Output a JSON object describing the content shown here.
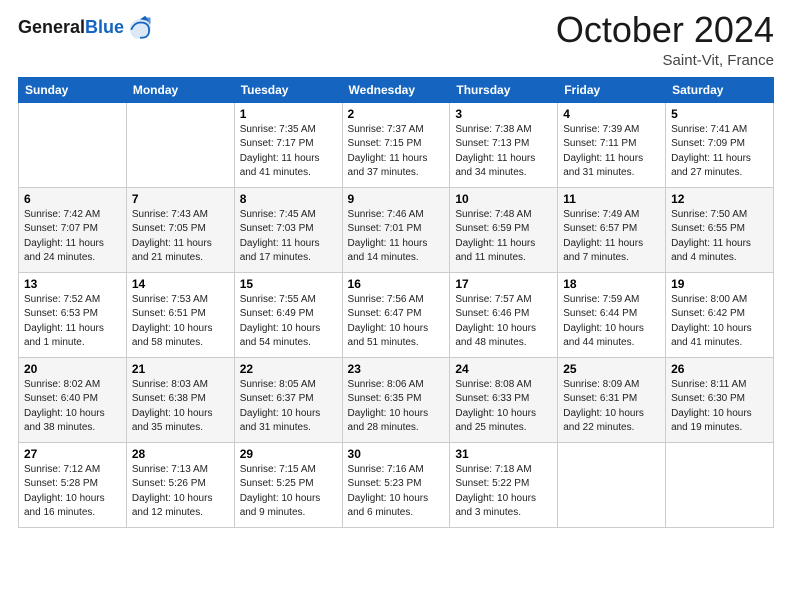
{
  "header": {
    "logo_general": "General",
    "logo_blue": "Blue",
    "month_title": "October 2024",
    "location": "Saint-Vit, France"
  },
  "days_of_week": [
    "Sunday",
    "Monday",
    "Tuesday",
    "Wednesday",
    "Thursday",
    "Friday",
    "Saturday"
  ],
  "weeks": [
    [
      {
        "day": "",
        "sunrise": "",
        "sunset": "",
        "daylight": ""
      },
      {
        "day": "",
        "sunrise": "",
        "sunset": "",
        "daylight": ""
      },
      {
        "day": "1",
        "sunrise": "Sunrise: 7:35 AM",
        "sunset": "Sunset: 7:17 PM",
        "daylight": "Daylight: 11 hours and 41 minutes."
      },
      {
        "day": "2",
        "sunrise": "Sunrise: 7:37 AM",
        "sunset": "Sunset: 7:15 PM",
        "daylight": "Daylight: 11 hours and 37 minutes."
      },
      {
        "day": "3",
        "sunrise": "Sunrise: 7:38 AM",
        "sunset": "Sunset: 7:13 PM",
        "daylight": "Daylight: 11 hours and 34 minutes."
      },
      {
        "day": "4",
        "sunrise": "Sunrise: 7:39 AM",
        "sunset": "Sunset: 7:11 PM",
        "daylight": "Daylight: 11 hours and 31 minutes."
      },
      {
        "day": "5",
        "sunrise": "Sunrise: 7:41 AM",
        "sunset": "Sunset: 7:09 PM",
        "daylight": "Daylight: 11 hours and 27 minutes."
      }
    ],
    [
      {
        "day": "6",
        "sunrise": "Sunrise: 7:42 AM",
        "sunset": "Sunset: 7:07 PM",
        "daylight": "Daylight: 11 hours and 24 minutes."
      },
      {
        "day": "7",
        "sunrise": "Sunrise: 7:43 AM",
        "sunset": "Sunset: 7:05 PM",
        "daylight": "Daylight: 11 hours and 21 minutes."
      },
      {
        "day": "8",
        "sunrise": "Sunrise: 7:45 AM",
        "sunset": "Sunset: 7:03 PM",
        "daylight": "Daylight: 11 hours and 17 minutes."
      },
      {
        "day": "9",
        "sunrise": "Sunrise: 7:46 AM",
        "sunset": "Sunset: 7:01 PM",
        "daylight": "Daylight: 11 hours and 14 minutes."
      },
      {
        "day": "10",
        "sunrise": "Sunrise: 7:48 AM",
        "sunset": "Sunset: 6:59 PM",
        "daylight": "Daylight: 11 hours and 11 minutes."
      },
      {
        "day": "11",
        "sunrise": "Sunrise: 7:49 AM",
        "sunset": "Sunset: 6:57 PM",
        "daylight": "Daylight: 11 hours and 7 minutes."
      },
      {
        "day": "12",
        "sunrise": "Sunrise: 7:50 AM",
        "sunset": "Sunset: 6:55 PM",
        "daylight": "Daylight: 11 hours and 4 minutes."
      }
    ],
    [
      {
        "day": "13",
        "sunrise": "Sunrise: 7:52 AM",
        "sunset": "Sunset: 6:53 PM",
        "daylight": "Daylight: 11 hours and 1 minute."
      },
      {
        "day": "14",
        "sunrise": "Sunrise: 7:53 AM",
        "sunset": "Sunset: 6:51 PM",
        "daylight": "Daylight: 10 hours and 58 minutes."
      },
      {
        "day": "15",
        "sunrise": "Sunrise: 7:55 AM",
        "sunset": "Sunset: 6:49 PM",
        "daylight": "Daylight: 10 hours and 54 minutes."
      },
      {
        "day": "16",
        "sunrise": "Sunrise: 7:56 AM",
        "sunset": "Sunset: 6:47 PM",
        "daylight": "Daylight: 10 hours and 51 minutes."
      },
      {
        "day": "17",
        "sunrise": "Sunrise: 7:57 AM",
        "sunset": "Sunset: 6:46 PM",
        "daylight": "Daylight: 10 hours and 48 minutes."
      },
      {
        "day": "18",
        "sunrise": "Sunrise: 7:59 AM",
        "sunset": "Sunset: 6:44 PM",
        "daylight": "Daylight: 10 hours and 44 minutes."
      },
      {
        "day": "19",
        "sunrise": "Sunrise: 8:00 AM",
        "sunset": "Sunset: 6:42 PM",
        "daylight": "Daylight: 10 hours and 41 minutes."
      }
    ],
    [
      {
        "day": "20",
        "sunrise": "Sunrise: 8:02 AM",
        "sunset": "Sunset: 6:40 PM",
        "daylight": "Daylight: 10 hours and 38 minutes."
      },
      {
        "day": "21",
        "sunrise": "Sunrise: 8:03 AM",
        "sunset": "Sunset: 6:38 PM",
        "daylight": "Daylight: 10 hours and 35 minutes."
      },
      {
        "day": "22",
        "sunrise": "Sunrise: 8:05 AM",
        "sunset": "Sunset: 6:37 PM",
        "daylight": "Daylight: 10 hours and 31 minutes."
      },
      {
        "day": "23",
        "sunrise": "Sunrise: 8:06 AM",
        "sunset": "Sunset: 6:35 PM",
        "daylight": "Daylight: 10 hours and 28 minutes."
      },
      {
        "day": "24",
        "sunrise": "Sunrise: 8:08 AM",
        "sunset": "Sunset: 6:33 PM",
        "daylight": "Daylight: 10 hours and 25 minutes."
      },
      {
        "day": "25",
        "sunrise": "Sunrise: 8:09 AM",
        "sunset": "Sunset: 6:31 PM",
        "daylight": "Daylight: 10 hours and 22 minutes."
      },
      {
        "day": "26",
        "sunrise": "Sunrise: 8:11 AM",
        "sunset": "Sunset: 6:30 PM",
        "daylight": "Daylight: 10 hours and 19 minutes."
      }
    ],
    [
      {
        "day": "27",
        "sunrise": "Sunrise: 7:12 AM",
        "sunset": "Sunset: 5:28 PM",
        "daylight": "Daylight: 10 hours and 16 minutes."
      },
      {
        "day": "28",
        "sunrise": "Sunrise: 7:13 AM",
        "sunset": "Sunset: 5:26 PM",
        "daylight": "Daylight: 10 hours and 12 minutes."
      },
      {
        "day": "29",
        "sunrise": "Sunrise: 7:15 AM",
        "sunset": "Sunset: 5:25 PM",
        "daylight": "Daylight: 10 hours and 9 minutes."
      },
      {
        "day": "30",
        "sunrise": "Sunrise: 7:16 AM",
        "sunset": "Sunset: 5:23 PM",
        "daylight": "Daylight: 10 hours and 6 minutes."
      },
      {
        "day": "31",
        "sunrise": "Sunrise: 7:18 AM",
        "sunset": "Sunset: 5:22 PM",
        "daylight": "Daylight: 10 hours and 3 minutes."
      },
      {
        "day": "",
        "sunrise": "",
        "sunset": "",
        "daylight": ""
      },
      {
        "day": "",
        "sunrise": "",
        "sunset": "",
        "daylight": ""
      }
    ]
  ]
}
